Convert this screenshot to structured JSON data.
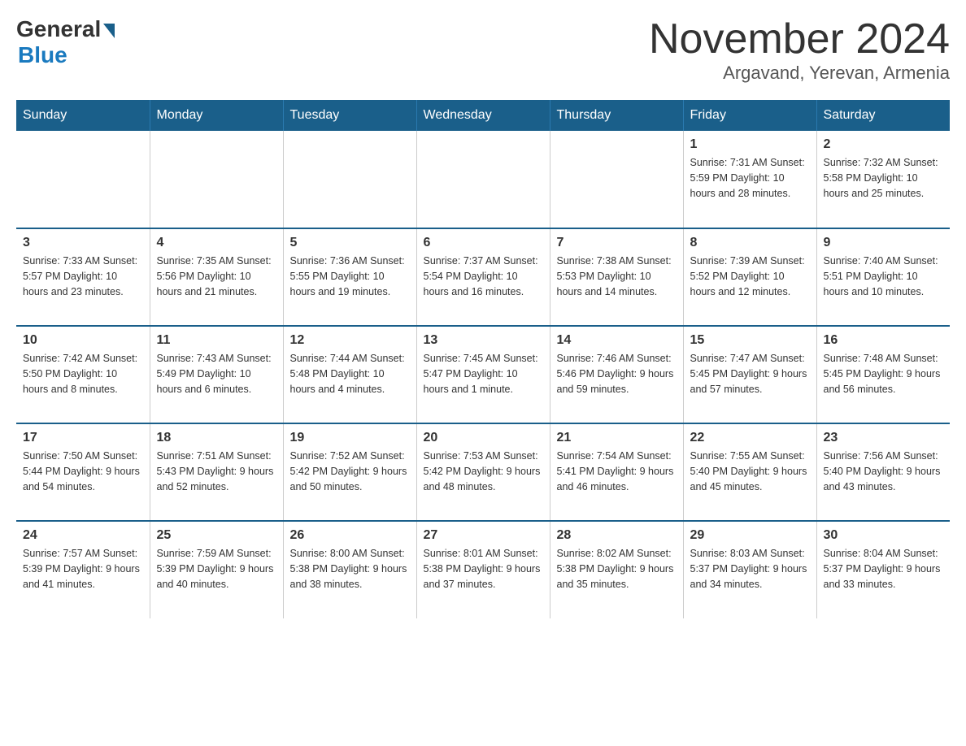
{
  "logo": {
    "general": "General",
    "blue": "Blue"
  },
  "title": "November 2024",
  "subtitle": "Argavand, Yerevan, Armenia",
  "weekdays": [
    "Sunday",
    "Monday",
    "Tuesday",
    "Wednesday",
    "Thursday",
    "Friday",
    "Saturday"
  ],
  "weeks": [
    [
      {
        "day": "",
        "info": ""
      },
      {
        "day": "",
        "info": ""
      },
      {
        "day": "",
        "info": ""
      },
      {
        "day": "",
        "info": ""
      },
      {
        "day": "",
        "info": ""
      },
      {
        "day": "1",
        "info": "Sunrise: 7:31 AM\nSunset: 5:59 PM\nDaylight: 10 hours and 28 minutes."
      },
      {
        "day": "2",
        "info": "Sunrise: 7:32 AM\nSunset: 5:58 PM\nDaylight: 10 hours and 25 minutes."
      }
    ],
    [
      {
        "day": "3",
        "info": "Sunrise: 7:33 AM\nSunset: 5:57 PM\nDaylight: 10 hours and 23 minutes."
      },
      {
        "day": "4",
        "info": "Sunrise: 7:35 AM\nSunset: 5:56 PM\nDaylight: 10 hours and 21 minutes."
      },
      {
        "day": "5",
        "info": "Sunrise: 7:36 AM\nSunset: 5:55 PM\nDaylight: 10 hours and 19 minutes."
      },
      {
        "day": "6",
        "info": "Sunrise: 7:37 AM\nSunset: 5:54 PM\nDaylight: 10 hours and 16 minutes."
      },
      {
        "day": "7",
        "info": "Sunrise: 7:38 AM\nSunset: 5:53 PM\nDaylight: 10 hours and 14 minutes."
      },
      {
        "day": "8",
        "info": "Sunrise: 7:39 AM\nSunset: 5:52 PM\nDaylight: 10 hours and 12 minutes."
      },
      {
        "day": "9",
        "info": "Sunrise: 7:40 AM\nSunset: 5:51 PM\nDaylight: 10 hours and 10 minutes."
      }
    ],
    [
      {
        "day": "10",
        "info": "Sunrise: 7:42 AM\nSunset: 5:50 PM\nDaylight: 10 hours and 8 minutes."
      },
      {
        "day": "11",
        "info": "Sunrise: 7:43 AM\nSunset: 5:49 PM\nDaylight: 10 hours and 6 minutes."
      },
      {
        "day": "12",
        "info": "Sunrise: 7:44 AM\nSunset: 5:48 PM\nDaylight: 10 hours and 4 minutes."
      },
      {
        "day": "13",
        "info": "Sunrise: 7:45 AM\nSunset: 5:47 PM\nDaylight: 10 hours and 1 minute."
      },
      {
        "day": "14",
        "info": "Sunrise: 7:46 AM\nSunset: 5:46 PM\nDaylight: 9 hours and 59 minutes."
      },
      {
        "day": "15",
        "info": "Sunrise: 7:47 AM\nSunset: 5:45 PM\nDaylight: 9 hours and 57 minutes."
      },
      {
        "day": "16",
        "info": "Sunrise: 7:48 AM\nSunset: 5:45 PM\nDaylight: 9 hours and 56 minutes."
      }
    ],
    [
      {
        "day": "17",
        "info": "Sunrise: 7:50 AM\nSunset: 5:44 PM\nDaylight: 9 hours and 54 minutes."
      },
      {
        "day": "18",
        "info": "Sunrise: 7:51 AM\nSunset: 5:43 PM\nDaylight: 9 hours and 52 minutes."
      },
      {
        "day": "19",
        "info": "Sunrise: 7:52 AM\nSunset: 5:42 PM\nDaylight: 9 hours and 50 minutes."
      },
      {
        "day": "20",
        "info": "Sunrise: 7:53 AM\nSunset: 5:42 PM\nDaylight: 9 hours and 48 minutes."
      },
      {
        "day": "21",
        "info": "Sunrise: 7:54 AM\nSunset: 5:41 PM\nDaylight: 9 hours and 46 minutes."
      },
      {
        "day": "22",
        "info": "Sunrise: 7:55 AM\nSunset: 5:40 PM\nDaylight: 9 hours and 45 minutes."
      },
      {
        "day": "23",
        "info": "Sunrise: 7:56 AM\nSunset: 5:40 PM\nDaylight: 9 hours and 43 minutes."
      }
    ],
    [
      {
        "day": "24",
        "info": "Sunrise: 7:57 AM\nSunset: 5:39 PM\nDaylight: 9 hours and 41 minutes."
      },
      {
        "day": "25",
        "info": "Sunrise: 7:59 AM\nSunset: 5:39 PM\nDaylight: 9 hours and 40 minutes."
      },
      {
        "day": "26",
        "info": "Sunrise: 8:00 AM\nSunset: 5:38 PM\nDaylight: 9 hours and 38 minutes."
      },
      {
        "day": "27",
        "info": "Sunrise: 8:01 AM\nSunset: 5:38 PM\nDaylight: 9 hours and 37 minutes."
      },
      {
        "day": "28",
        "info": "Sunrise: 8:02 AM\nSunset: 5:38 PM\nDaylight: 9 hours and 35 minutes."
      },
      {
        "day": "29",
        "info": "Sunrise: 8:03 AM\nSunset: 5:37 PM\nDaylight: 9 hours and 34 minutes."
      },
      {
        "day": "30",
        "info": "Sunrise: 8:04 AM\nSunset: 5:37 PM\nDaylight: 9 hours and 33 minutes."
      }
    ]
  ]
}
